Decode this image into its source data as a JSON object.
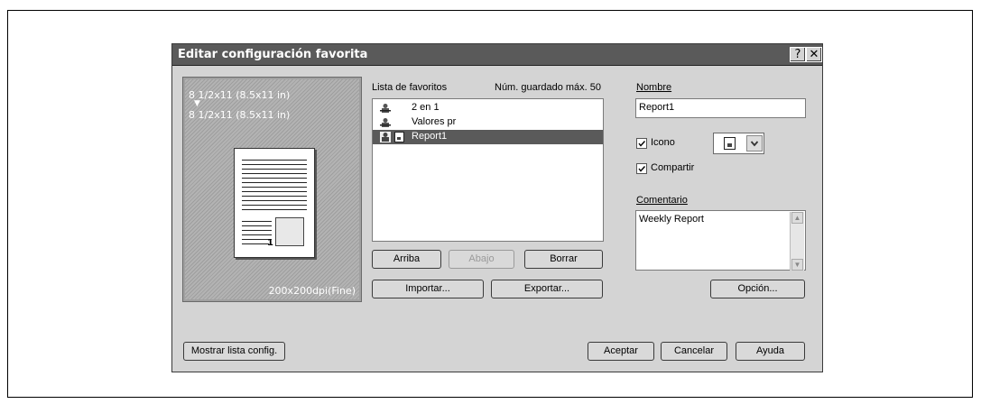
{
  "dialog": {
    "title": "Editar configuración favorita",
    "help_glyph": "?",
    "close_glyph": "✕"
  },
  "preview": {
    "paper_from": "8 1/2x11 (8.5x11 in)",
    "arrow": "▼",
    "paper_to": "8 1/2x11 (8.5x11 in)",
    "page_number": "1",
    "resolution": "200x200dpi(Fine)"
  },
  "favorites": {
    "label": "Lista de favoritos",
    "max_saved": "Núm. guardado máx. 50",
    "items": [
      {
        "label": "2 en 1",
        "icon": "favorite-icon"
      },
      {
        "label": "Valores pr",
        "icon": "favorite-icon"
      },
      {
        "label": "Report1",
        "icon": "favorite-icon",
        "selected": true
      }
    ],
    "up_button": "Arriba",
    "down_button": "Abajo",
    "delete_button": "Borrar",
    "import_button": "Importar...",
    "export_button": "Exportar..."
  },
  "name": {
    "label": "Nombre",
    "value": "Report1"
  },
  "icon_option": {
    "label": "Icono",
    "checked": true
  },
  "share_option": {
    "label": "Compartir",
    "checked": true
  },
  "comment": {
    "label": "Comentario",
    "value": "Weekly Report"
  },
  "buttons": {
    "option": "Opción...",
    "show_list": "Mostrar lista config.",
    "accept": "Aceptar",
    "cancel": "Cancelar",
    "help": "Ayuda"
  }
}
